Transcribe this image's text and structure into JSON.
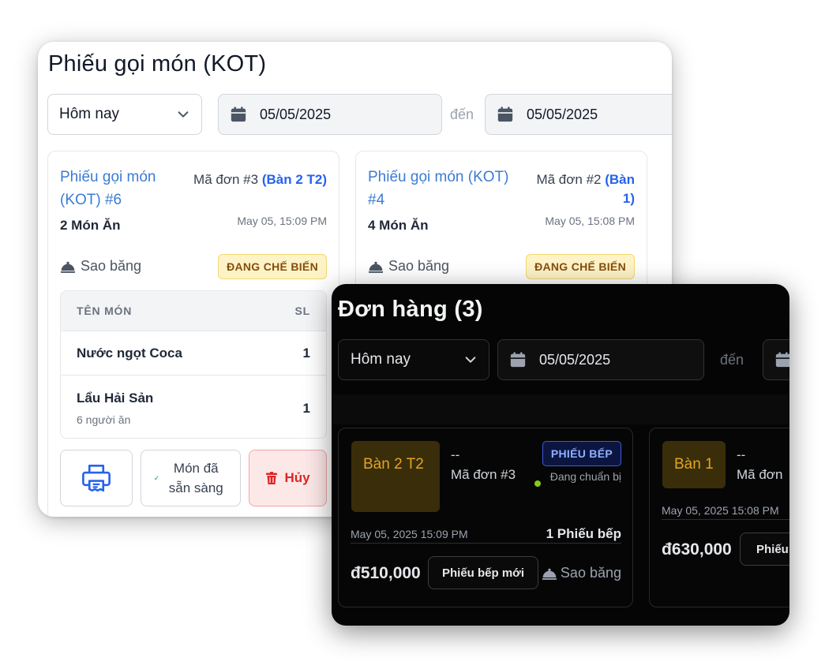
{
  "kot": {
    "title": "Phiếu gọi món (KOT)",
    "filter": {
      "value": "Hôm nay"
    },
    "date_from": "05/05/2025",
    "separator": "đến",
    "date_to": "05/05/2025",
    "cards": [
      {
        "title": "Phiếu gọi món (KOT) #6",
        "order_label": "Mã đơn #3",
        "table": "(Bàn 2 T2)",
        "time": "May 05, 15:09 PM",
        "count": "2 Món Ăn",
        "user": "Sao băng",
        "status": "ĐANG CHẾ BIẾN",
        "items_header": {
          "name": "TÊN MÓN",
          "qty": "SL"
        },
        "items": [
          {
            "name": "Nước ngọt Coca",
            "note": "",
            "qty": "1"
          },
          {
            "name": "Lẩu Hải Sản",
            "note": "6 người ăn",
            "qty": "1"
          }
        ],
        "ready_label": "Món đã sẵn sàng",
        "cancel_label": "Hủy"
      },
      {
        "title": "Phiếu gọi món (KOT) #4",
        "order_label": "Mã đơn #2",
        "table": "(Bàn 1)",
        "time": "May 05, 15:08 PM",
        "count": "4 Món Ăn",
        "user": "Sao băng",
        "status": "ĐANG CHẾ BIẾN"
      }
    ]
  },
  "orders": {
    "title": "Đơn hàng (3)",
    "filter": {
      "value": "Hôm nay"
    },
    "date_from": "05/05/2025",
    "separator": "đến",
    "cards": [
      {
        "table": "Bàn 2 T2",
        "dash": "--",
        "code": "Mã đơn #3",
        "badge": "PHIẾU BẾP",
        "status": "Đang chuẩn bị",
        "time": "May 05, 2025 15:09 PM",
        "kitchen_count": "1 Phiếu bếp",
        "price": "đ510,000",
        "new_kot": "Phiếu bếp mới",
        "user": "Sao băng"
      },
      {
        "table": "Bàn 1",
        "dash": "--",
        "code": "Mã đơn",
        "time": "May 05, 2025 15:08 PM",
        "price": "đ630,000",
        "new_kot": "Phiếu"
      }
    ]
  },
  "colors": {
    "link_blue": "#3b7bd4",
    "badge_yellow": "#fef3c7",
    "cancel_red": "#dc2626",
    "dark_bg": "#050505",
    "table_gold": "#e0a526",
    "status_green": "#84cc16"
  },
  "icons": [
    "chevron-down-icon",
    "calendar-icon",
    "waiter-icon",
    "printer-icon",
    "check-icon",
    "trash-icon"
  ]
}
